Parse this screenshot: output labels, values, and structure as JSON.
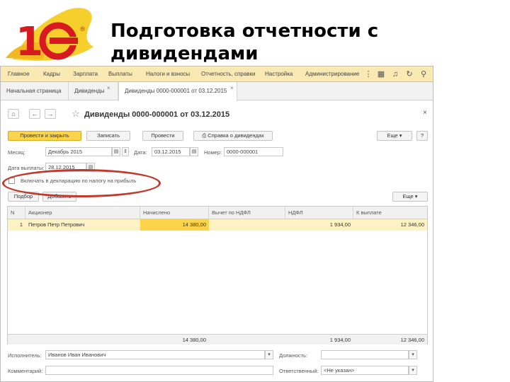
{
  "slide": {
    "title": "Подготовка отчетности с дивидендами",
    "logo_text": "1С"
  },
  "menubar": {
    "items": [
      "Главное",
      "Кадры",
      "Зарплата",
      "Выплаты",
      "Налоги и взносы",
      "Отчетность, справки",
      "Настройка",
      "Администрирование"
    ],
    "icons": [
      "more-icon",
      "grid-icon",
      "bell-icon",
      "history-icon",
      "search-icon"
    ]
  },
  "tabs": {
    "items": [
      {
        "label": "Начальная страница"
      },
      {
        "label": "Дивиденды"
      },
      {
        "label": "Дивиденды 0000-000001 от 03.12.2015"
      }
    ],
    "close_glyph": "×"
  },
  "document": {
    "title": "Дивиденды 0000-000001 от 03.12.2015",
    "close_glyph": "×"
  },
  "toolbar": {
    "post_close": "Провести и закрыть",
    "save": "Записать",
    "post": "Провести",
    "certificate": "Справка о дивидендах",
    "more": "Еще",
    "help": "?"
  },
  "form": {
    "month_label": "Месяц:",
    "month_value": "Декабрь 2015",
    "date_label": "Дата:",
    "date_value": "03.12.2015",
    "number_label": "Номер:",
    "number_value": "0000-000001",
    "pay_date_label": "Дата выплаты:",
    "pay_date_value": "28.12.2015",
    "include_label": "Включать в декларацию по налогу на прибыль"
  },
  "table_toolbar": {
    "pick": "Подбор",
    "add": "Добавить",
    "more": "Еще"
  },
  "table": {
    "headers": [
      "N",
      "Акционер",
      "Начислено",
      "Вычет по НДФЛ",
      "НДФЛ",
      "К выплате"
    ],
    "rows": [
      {
        "n": "1",
        "holder": "Петров Петр Петрович",
        "accrued": "14 380,00",
        "deduction": "",
        "ndfl": "1 934,00",
        "payout": "12 346,00"
      }
    ],
    "totals": {
      "accrued": "14 380,00",
      "ndfl": "1 934,00",
      "payout": "12 346,00"
    }
  },
  "footer": {
    "executor_label": "Исполнитель:",
    "executor_value": "Иванов Иван Иванович",
    "position_label": "Должность:",
    "position_value": "",
    "comment_label": "Комментарий:",
    "comment_value": "",
    "responsible_label": "Ответственный:",
    "responsible_value": "<Не указан>"
  },
  "colors": {
    "accent_yellow": "#fbd44b",
    "menubar": "#fbe9b4",
    "row_highlight": "#fdf2c3",
    "logo_red": "#d71920",
    "annotation_red": "#c0392b"
  }
}
